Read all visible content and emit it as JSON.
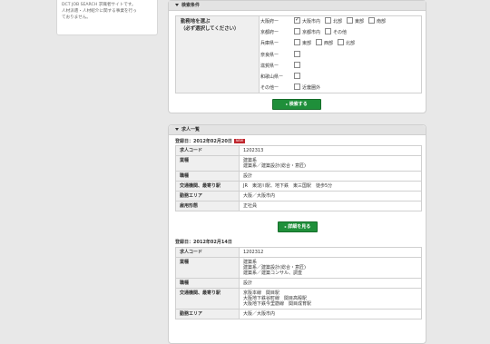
{
  "sidebar": {
    "text_line1": "DCT JOB SEARCH 求職者サイトです。",
    "text_line2": "人材派遣・人材紹介に関する事業を行っ",
    "text_line3": "ておりません。"
  },
  "search": {
    "header": "検索条件",
    "condition_label_line1": "勤務地を選ぶ",
    "condition_label_line2": "（必ず選択してください）",
    "prefectures": [
      {
        "name": "大阪府ー",
        "options": [
          {
            "label": "大阪市内",
            "checked": true
          },
          {
            "label": "北部",
            "checked": false
          },
          {
            "label": "東部",
            "checked": false
          },
          {
            "label": "南部",
            "checked": false
          }
        ]
      },
      {
        "name": "京都府ー",
        "options": [
          {
            "label": "京都市内",
            "checked": false
          },
          {
            "label": "その他",
            "checked": false
          }
        ]
      },
      {
        "name": "兵庫県ー",
        "options": [
          {
            "label": "東部",
            "checked": false
          },
          {
            "label": "西部",
            "checked": false
          },
          {
            "label": "北部",
            "checked": false
          }
        ]
      },
      {
        "name": "奈良県ー",
        "options": [
          {
            "label": "",
            "checked": false
          }
        ]
      },
      {
        "name": "滋賀県ー",
        "options": [
          {
            "label": "",
            "checked": false
          }
        ]
      },
      {
        "name": "和歌山県ー",
        "options": [
          {
            "label": "",
            "checked": false
          }
        ]
      },
      {
        "name": "その他ー",
        "options": [
          {
            "label": "近畿圏外",
            "checked": false
          }
        ]
      }
    ],
    "search_button": "検索する"
  },
  "results": {
    "header": "求人一覧",
    "jobs": [
      {
        "date_label": "登録日：2012年02月20日",
        "badge": "NEW",
        "rows": [
          {
            "label": "求人コード",
            "value": "1202313"
          },
          {
            "label": "業種",
            "value": "建築系\n建築系／建築設計(総合・意匠)"
          },
          {
            "label": "職種",
            "value": "設計"
          },
          {
            "label": "交通機関、最寄り駅",
            "value": "JR　東淀川駅、地下鉄　東三国駅　徒歩5分"
          },
          {
            "label": "勤務エリア",
            "value": "大阪／大阪市内"
          },
          {
            "label": "雇用形態",
            "value": "正社員"
          }
        ],
        "detail_button": "詳細を見る"
      },
      {
        "date_label": "登録日：2012年02月14日",
        "badge": "",
        "rows": [
          {
            "label": "求人コード",
            "value": "1202312"
          },
          {
            "label": "業種",
            "value": "建築系\n建築系／建築設計(総合・意匠)\n建築系／建築コンサル、調査"
          },
          {
            "label": "職種",
            "value": "設計"
          },
          {
            "label": "交通機関、最寄り駅",
            "value": "京阪本線　関目駅\n大阪地下鉄谷町線　関目高殿駅\n大阪地下鉄今里筋線　関目成育駅"
          },
          {
            "label": "勤務エリア",
            "value": "大阪／大阪市内"
          }
        ]
      }
    ]
  }
}
